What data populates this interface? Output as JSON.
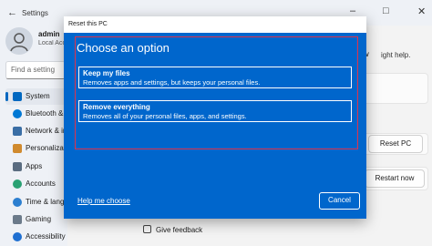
{
  "window": {
    "app_title": "Settings",
    "back_icon": "back-arrow-icon",
    "minimize_icon": "minimize-icon",
    "maximize_icon": "maximize-icon",
    "close_icon": "close-icon"
  },
  "user": {
    "name": "admin",
    "account": "Local Account"
  },
  "search": {
    "placeholder": "Find a setting"
  },
  "sidebar": {
    "items": [
      {
        "label": "System",
        "icon": "system-icon",
        "color": "#0067c0"
      },
      {
        "label": "Bluetooth & devices",
        "icon": "bluetooth-icon",
        "color": "#0078d4"
      },
      {
        "label": "Network & internet",
        "icon": "network-icon",
        "color": "#3a6ea5"
      },
      {
        "label": "Personalization",
        "icon": "brush-icon",
        "color": "#d08a2e"
      },
      {
        "label": "Apps",
        "icon": "apps-icon",
        "color": "#5a6c80"
      },
      {
        "label": "Accounts",
        "icon": "accounts-icon",
        "color": "#2aa173"
      },
      {
        "label": "Time & language",
        "icon": "clock-icon",
        "color": "#2c7fd0"
      },
      {
        "label": "Gaming",
        "icon": "gaming-icon",
        "color": "#6b7a8a"
      },
      {
        "label": "Accessibility",
        "icon": "accessibility-icon",
        "color": "#1e6fd1"
      }
    ]
  },
  "main": {
    "help_partial": "ight help.",
    "reset_button": "Reset PC",
    "restart_button": "Restart now",
    "feedback_link": "Give feedback"
  },
  "dialog": {
    "title": "Reset this PC",
    "heading": "Choose an option",
    "options": [
      {
        "title": "Keep my files",
        "description": "Removes apps and settings, but keeps your personal files."
      },
      {
        "title": "Remove everything",
        "description": "Removes all of your personal files, apps, and settings."
      }
    ],
    "help_link": "Help me choose",
    "cancel_button": "Cancel",
    "highlight_color": "#e0334b",
    "background_color": "#0066cc"
  }
}
